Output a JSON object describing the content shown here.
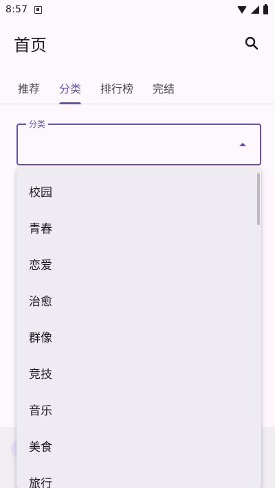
{
  "status_bar": {
    "time": "8:57"
  },
  "app_bar": {
    "title": "首页"
  },
  "tabs": [
    {
      "label": "推荐",
      "active": false
    },
    {
      "label": "分类",
      "active": true
    },
    {
      "label": "排行榜",
      "active": false
    },
    {
      "label": "完结",
      "active": false
    }
  ],
  "select": {
    "label": "分类",
    "value": ""
  },
  "dropdown": {
    "options": [
      "校园",
      "青春",
      "恋爱",
      "治愈",
      "群像",
      "竞技",
      "音乐",
      "美食",
      "旅行"
    ]
  },
  "colors": {
    "accent": "#6750a4",
    "background": "#fdf8fd",
    "menu_background": "#efebf2"
  }
}
